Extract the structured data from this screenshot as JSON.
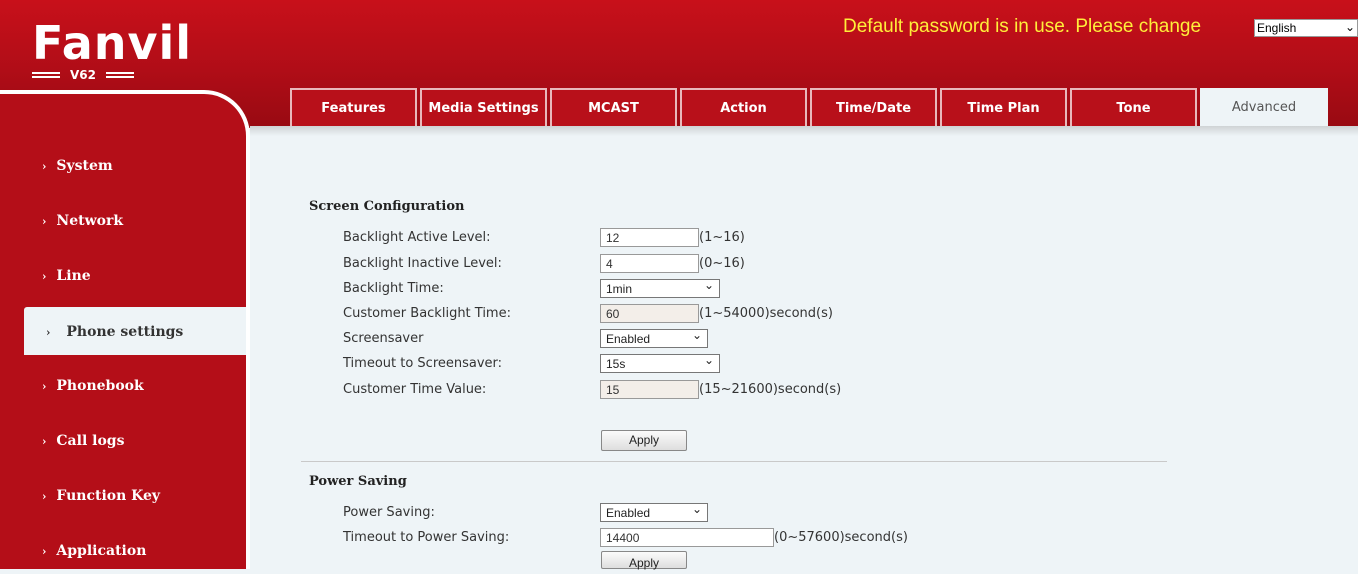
{
  "header": {
    "brand": "Fanvil",
    "model": "V62",
    "warning": "Default password is in use. Please change",
    "language": "English"
  },
  "tabs": [
    {
      "label": "Features"
    },
    {
      "label": "Media Settings"
    },
    {
      "label": "MCAST"
    },
    {
      "label": "Action"
    },
    {
      "label": "Time/Date"
    },
    {
      "label": "Time Plan"
    },
    {
      "label": "Tone"
    },
    {
      "label": "Advanced"
    }
  ],
  "sidebar": {
    "items": [
      {
        "label": "System"
      },
      {
        "label": "Network"
      },
      {
        "label": "Line"
      },
      {
        "label": "Phone settings"
      },
      {
        "label": "Phonebook"
      },
      {
        "label": "Call logs"
      },
      {
        "label": "Function Key"
      },
      {
        "label": "Application"
      }
    ],
    "active": "Phone settings"
  },
  "screen": {
    "title": "Screen Configuration",
    "backlight_active": {
      "label": "Backlight Active Level:",
      "value": "12",
      "hint": "(1~16)"
    },
    "backlight_inactive": {
      "label": "Backlight Inactive Level:",
      "value": "4",
      "hint": "(0~16)"
    },
    "backlight_time": {
      "label": "Backlight Time:",
      "value": "1min"
    },
    "customer_backlight": {
      "label": "Customer Backlight Time:",
      "value": "60",
      "hint": "(1~54000)second(s)"
    },
    "screensaver": {
      "label": "Screensaver",
      "value": "Enabled"
    },
    "timeout_screensaver": {
      "label": "Timeout to Screensaver:",
      "value": "15s"
    },
    "customer_time": {
      "label": "Customer Time Value:",
      "value": "15",
      "hint": "(15~21600)second(s)"
    },
    "apply": "Apply"
  },
  "power": {
    "title": "Power Saving",
    "power_saving": {
      "label": "Power Saving:",
      "value": "Enabled"
    },
    "timeout_power": {
      "label": "Timeout to Power Saving:",
      "value": "14400",
      "hint": "(0~57600)second(s)"
    },
    "apply": "Apply"
  },
  "colors": {
    "brand_red": "#b40e18",
    "warning_yellow": "#ffee3a",
    "content_bg": "#eef4f7"
  }
}
